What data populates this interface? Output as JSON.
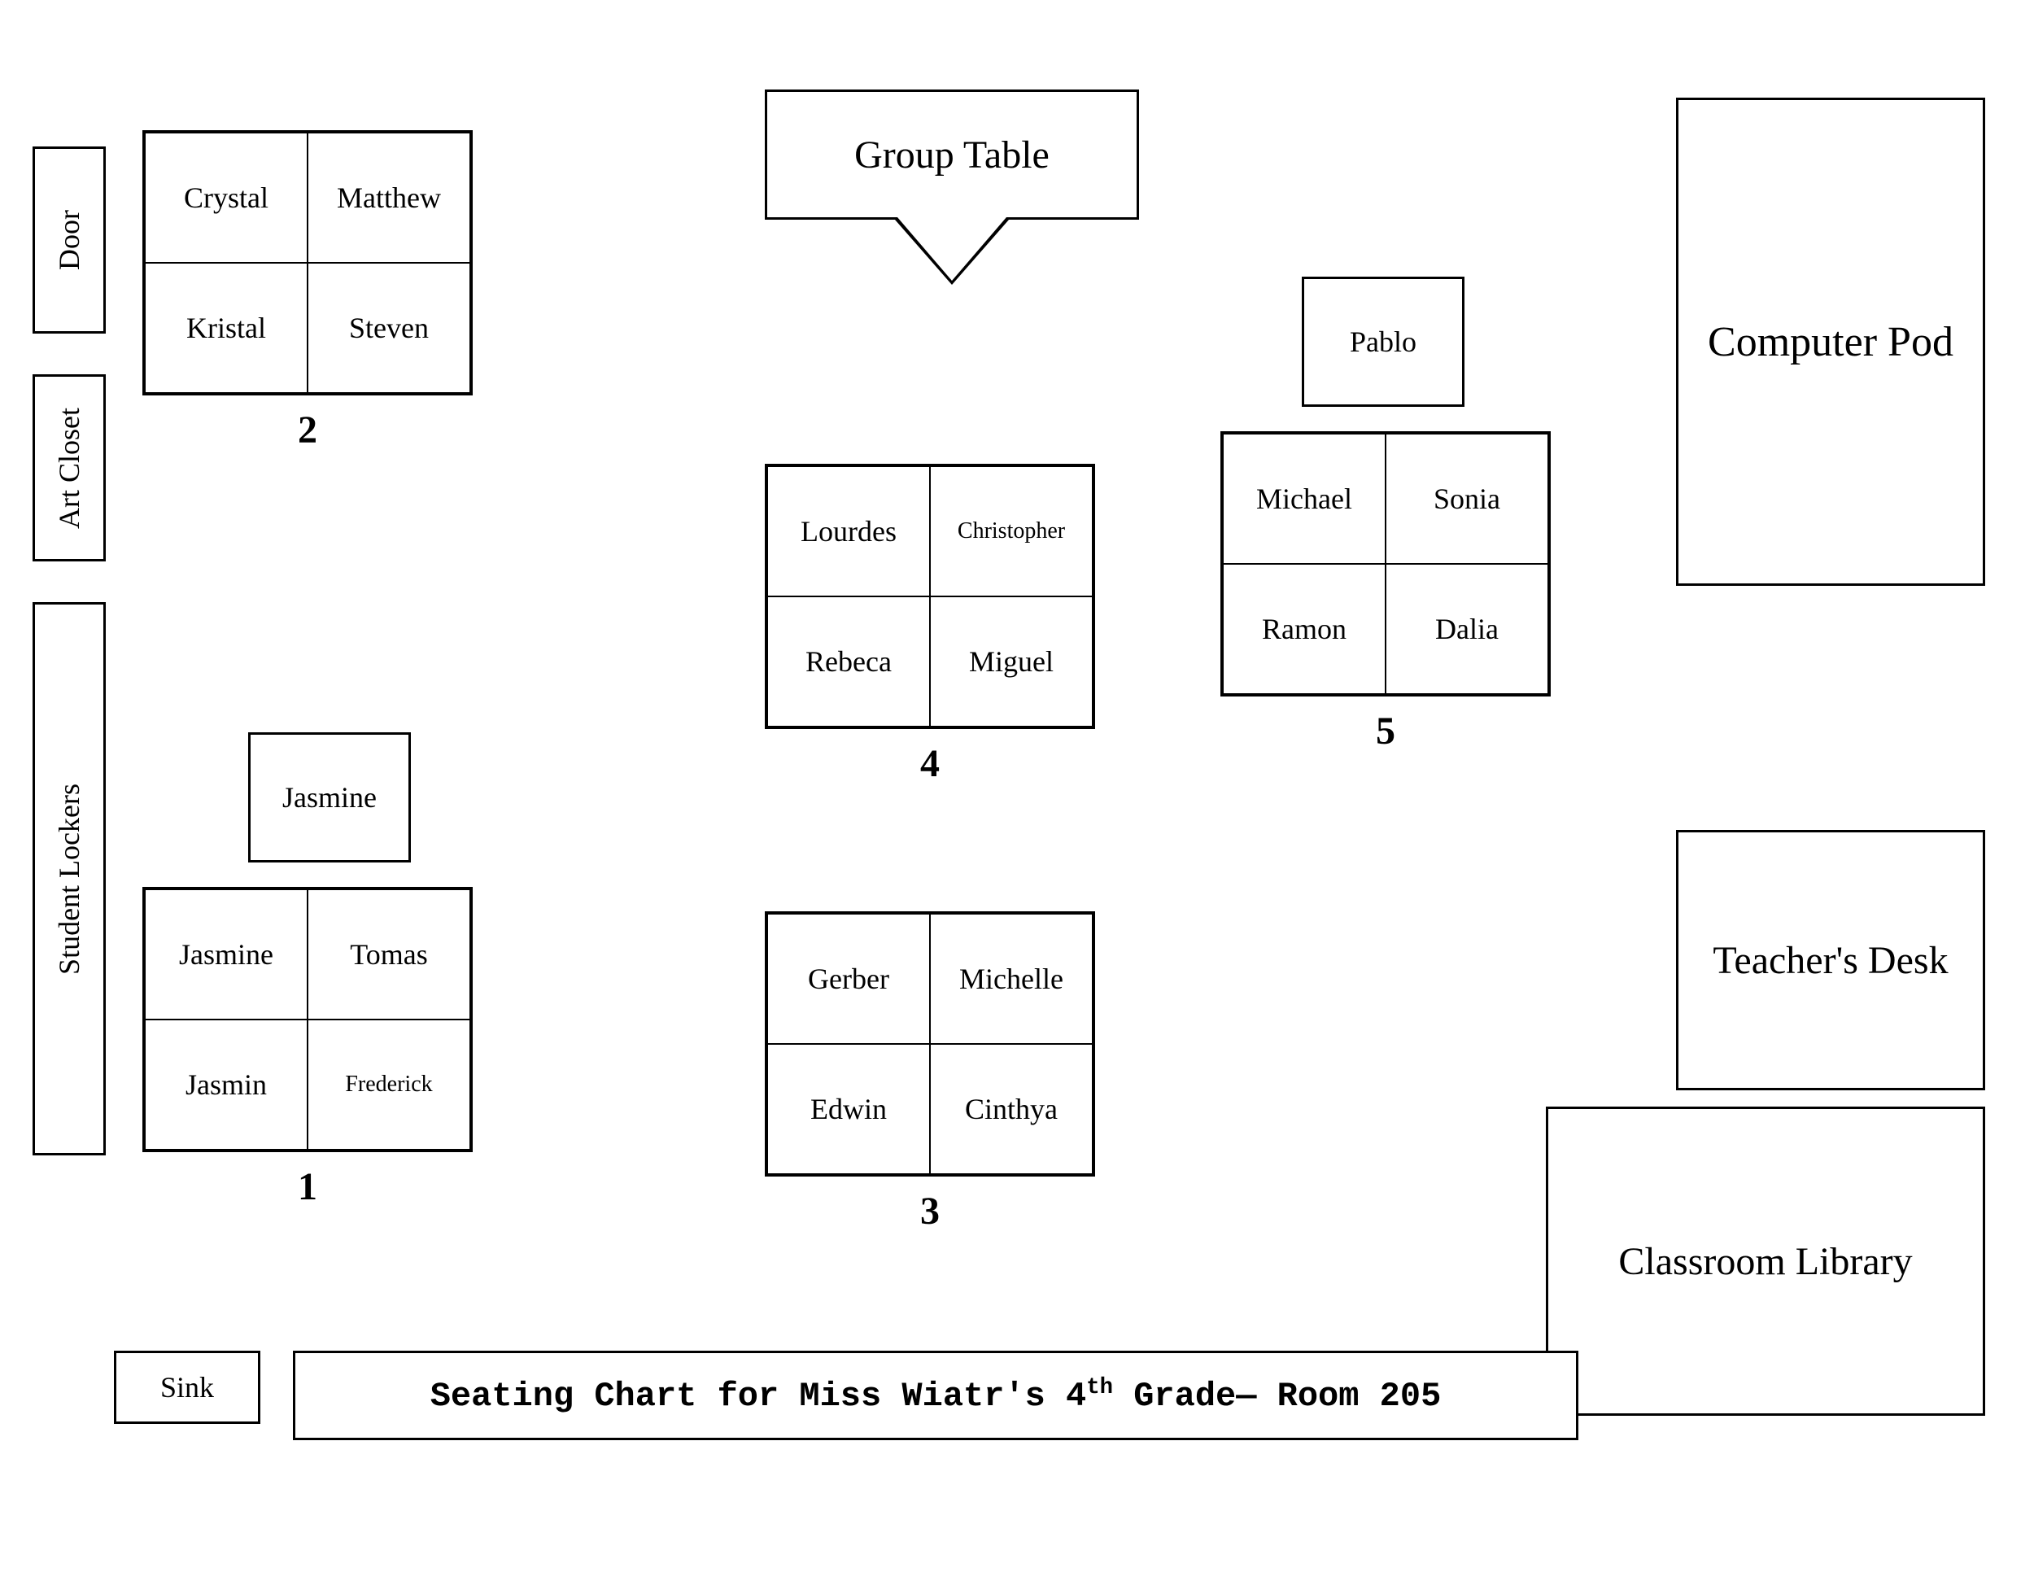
{
  "page": {
    "title": "Seating Chart",
    "subtitle": "Miss Wiatr's 4th Grade— Room 205"
  },
  "labels": {
    "door": "Door",
    "art_closet": "Art Closet",
    "student_lockers": "Student Lockers",
    "sink": "Sink",
    "computer_pod": "Computer Pod",
    "teachers_desk": "Teacher's Desk",
    "classroom_library": "Classroom Library",
    "group_table": "Group Table"
  },
  "clusters": {
    "cluster2": {
      "number": "2",
      "students": [
        "Crystal",
        "Matthew",
        "Kristal",
        "Steven"
      ]
    },
    "cluster4": {
      "number": "4",
      "students": [
        "Lourdes",
        "Christopher",
        "Rebeca",
        "Miguel"
      ]
    },
    "cluster5": {
      "number": "5",
      "students": [
        "Michael",
        "Sonia",
        "Ramon",
        "Dalia"
      ],
      "extra": "Pablo"
    },
    "cluster1": {
      "number": "1",
      "students": [
        "Jasmine",
        "Tomas",
        "Jasmin",
        "Frederick"
      ],
      "extra": "Jasmine"
    },
    "cluster3": {
      "number": "3",
      "students": [
        "Gerber",
        "Michelle",
        "Edwin",
        "Cinthya"
      ]
    }
  }
}
